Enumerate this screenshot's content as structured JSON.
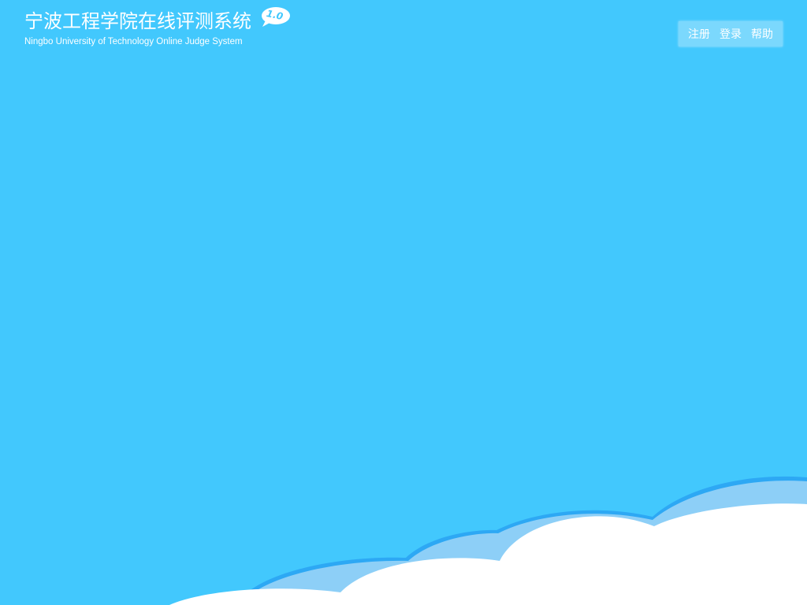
{
  "header": {
    "title": "宁波工程学院在线评测系统",
    "subtitle": "Ningbo University of Technology Online Judge System",
    "version": "1.0"
  },
  "nav": {
    "items": [
      {
        "label": "注册",
        "name": "register-link"
      },
      {
        "label": "登录",
        "name": "login-link"
      },
      {
        "label": "帮助",
        "name": "help-link"
      }
    ]
  },
  "colors": {
    "background": "#42c8fd",
    "cloud_shadow": "#8dcff7",
    "cloud_edge": "#2da8f4",
    "cloud_white": "#ffffff"
  }
}
